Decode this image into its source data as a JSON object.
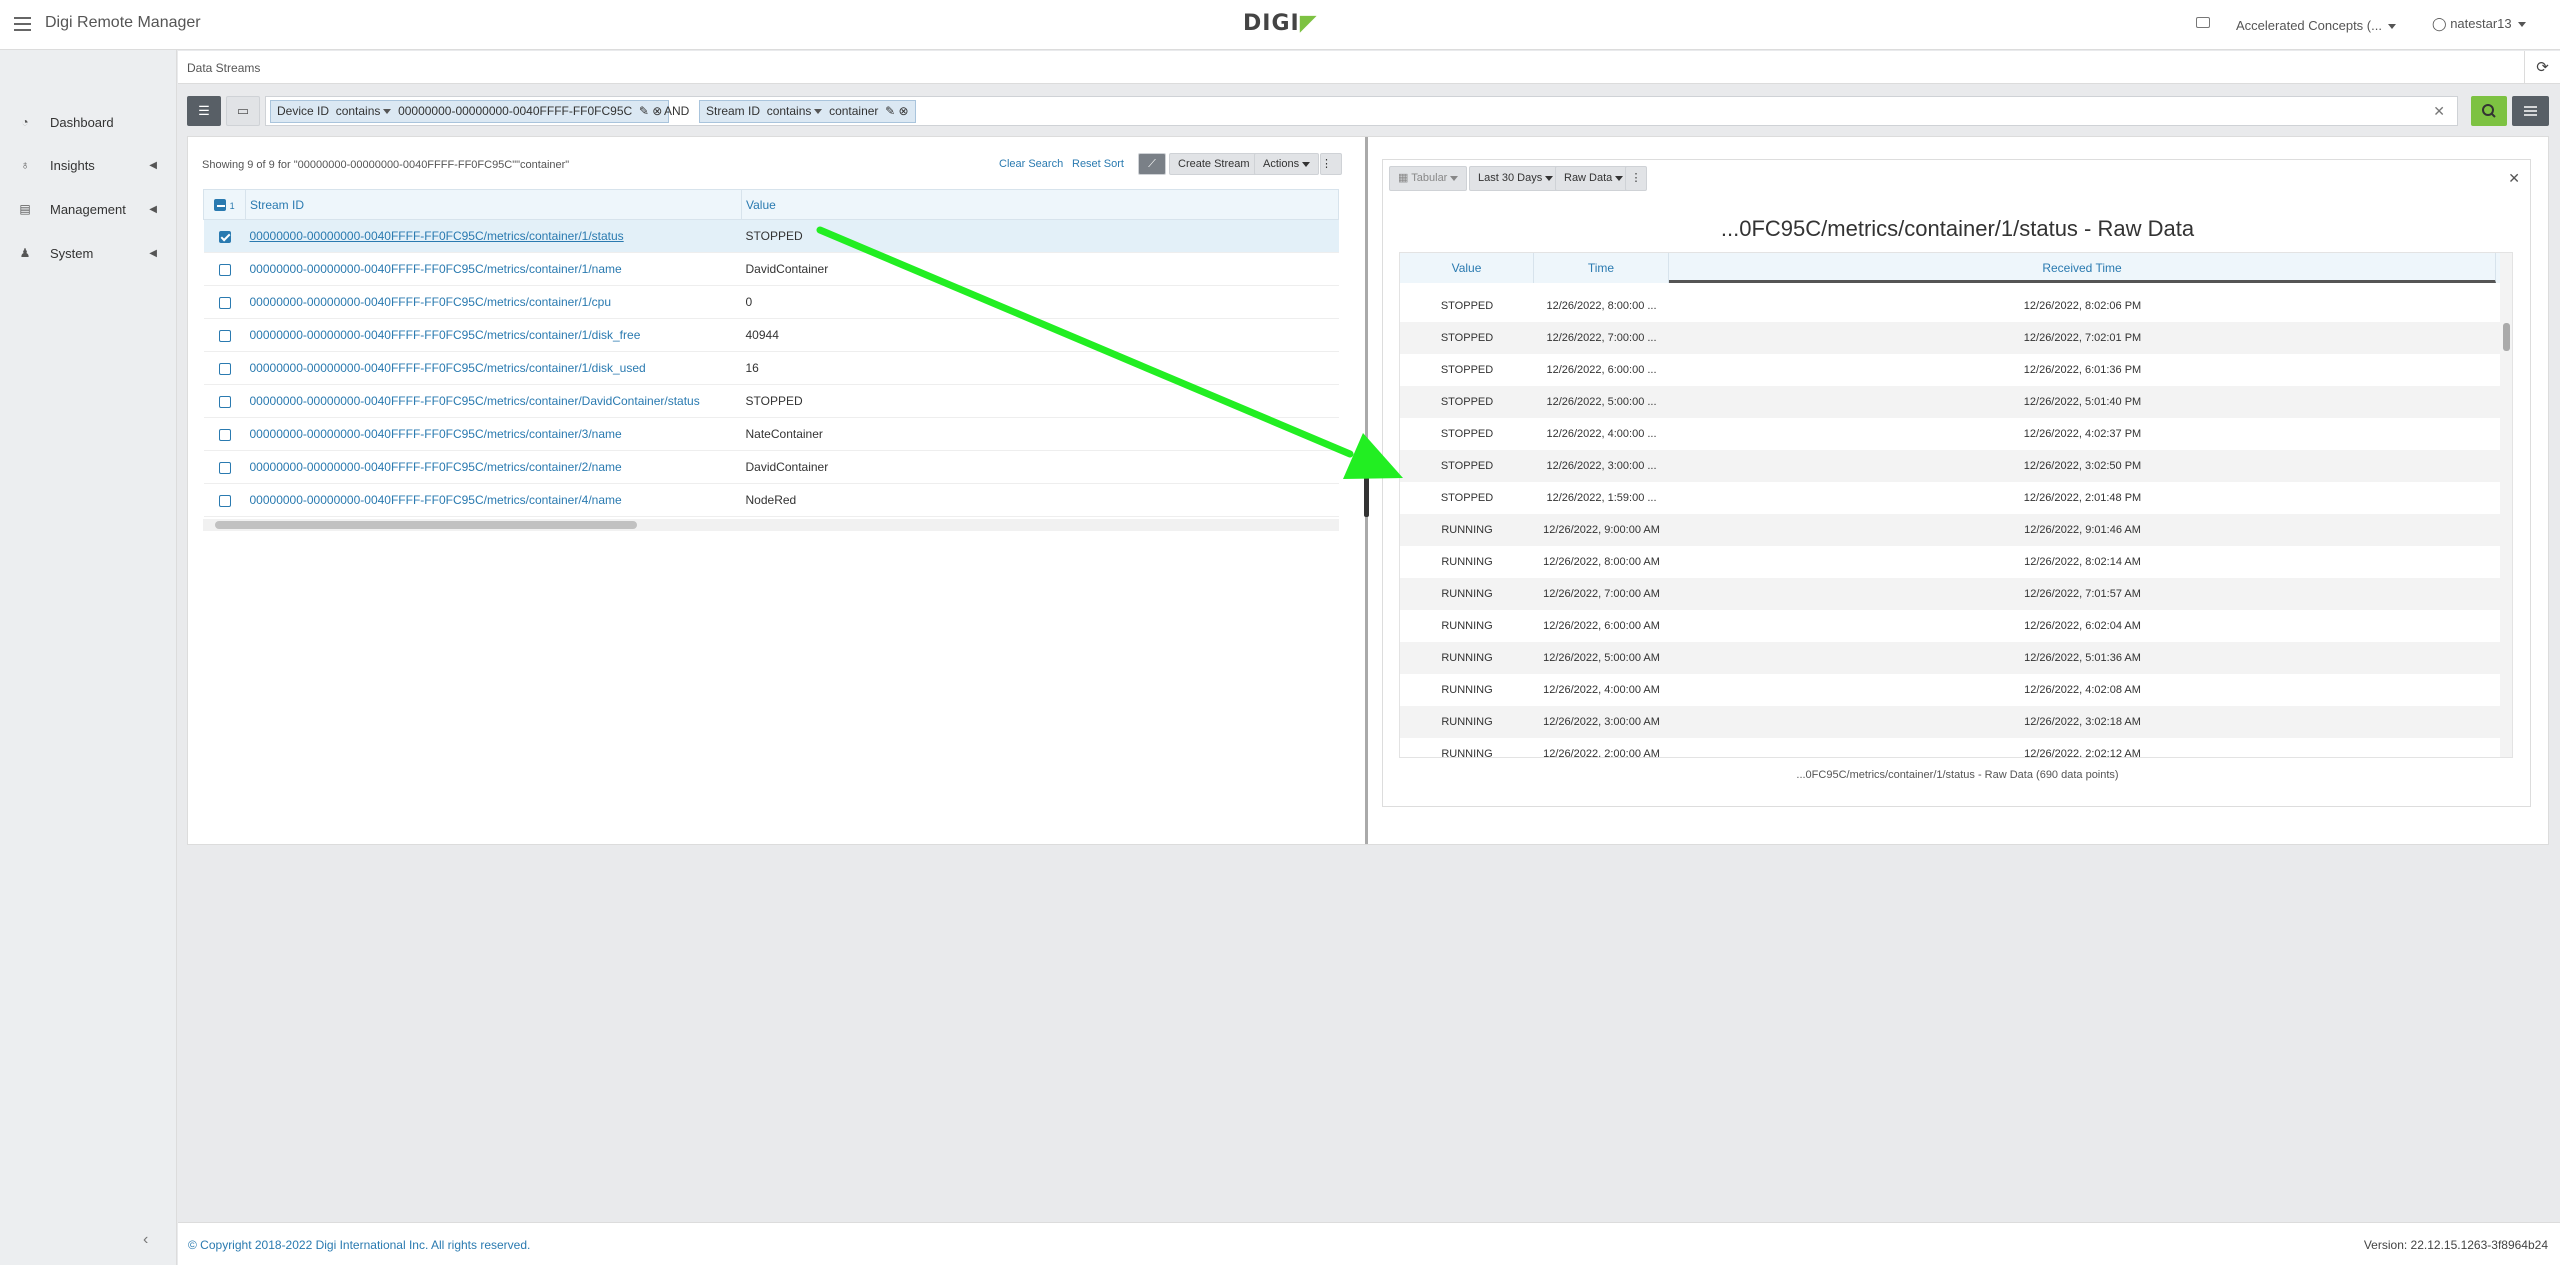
{
  "app": {
    "title": "Digi Remote Manager",
    "logo_text": "DIGI"
  },
  "header": {
    "org": "Accelerated Concepts (...",
    "user": "natestar13"
  },
  "sidebar": {
    "items": [
      {
        "label": "Dashboard",
        "icon": "gauge-icon"
      },
      {
        "label": "Insights",
        "icon": "lightbulb-icon"
      },
      {
        "label": "Management",
        "icon": "server-icon"
      },
      {
        "label": "System",
        "icon": "user-cog-icon"
      }
    ]
  },
  "breadcrumb": "Data Streams",
  "filter": {
    "chip1": {
      "field": "Device ID",
      "op": "contains",
      "value": "00000000-00000000-0040FFFF-FF0FC95C"
    },
    "and": "AND",
    "chip2": {
      "field": "Stream ID",
      "op": "contains",
      "value": "container"
    }
  },
  "list": {
    "showing": "Showing 9 of 9 for \"00000000-00000000-0040FFFF-FF0FC95C\"\"container\"",
    "clear_search": "Clear Search",
    "reset_sort": "Reset Sort",
    "create_stream": "Create Stream",
    "actions": "Actions",
    "sort_index": "1",
    "col_stream": "Stream ID",
    "col_value": "Value",
    "rows": [
      {
        "id": "00000000-00000000-0040FFFF-FF0FC95C/metrics/container/1/status",
        "value": "STOPPED"
      },
      {
        "id": "00000000-00000000-0040FFFF-FF0FC95C/metrics/container/1/name",
        "value": "DavidContainer"
      },
      {
        "id": "00000000-00000000-0040FFFF-FF0FC95C/metrics/container/1/cpu",
        "value": "0"
      },
      {
        "id": "00000000-00000000-0040FFFF-FF0FC95C/metrics/container/1/disk_free",
        "value": "40944"
      },
      {
        "id": "00000000-00000000-0040FFFF-FF0FC95C/metrics/container/1/disk_used",
        "value": "16"
      },
      {
        "id": "00000000-00000000-0040FFFF-FF0FC95C/metrics/container/DavidContainer/status",
        "value": "STOPPED"
      },
      {
        "id": "00000000-00000000-0040FFFF-FF0FC95C/metrics/container/3/name",
        "value": "NateContainer"
      },
      {
        "id": "00000000-00000000-0040FFFF-FF0FC95C/metrics/container/2/name",
        "value": "DavidContainer"
      },
      {
        "id": "00000000-00000000-0040FFFF-FF0FC95C/metrics/container/4/name",
        "value": "NodeRed"
      }
    ]
  },
  "detail": {
    "view": "Tabular",
    "range": "Last 30 Days",
    "data_type": "Raw Data",
    "title": "...0FC95C/metrics/container/1/status - Raw Data",
    "col_value": "Value",
    "col_time": "Time",
    "col_received": "Received Time",
    "rows": [
      {
        "value": "STOPPED",
        "time": "12/26/2022, 8:00:00 ...",
        "received": "12/26/2022, 8:02:06 PM"
      },
      {
        "value": "STOPPED",
        "time": "12/26/2022, 7:00:00 ...",
        "received": "12/26/2022, 7:02:01 PM"
      },
      {
        "value": "STOPPED",
        "time": "12/26/2022, 6:00:00 ...",
        "received": "12/26/2022, 6:01:36 PM"
      },
      {
        "value": "STOPPED",
        "time": "12/26/2022, 5:00:00 ...",
        "received": "12/26/2022, 5:01:40 PM"
      },
      {
        "value": "STOPPED",
        "time": "12/26/2022, 4:00:00 ...",
        "received": "12/26/2022, 4:02:37 PM"
      },
      {
        "value": "STOPPED",
        "time": "12/26/2022, 3:00:00 ...",
        "received": "12/26/2022, 3:02:50 PM"
      },
      {
        "value": "STOPPED",
        "time": "12/26/2022, 1:59:00 ...",
        "received": "12/26/2022, 2:01:48 PM"
      },
      {
        "value": "RUNNING",
        "time": "12/26/2022, 9:00:00 AM",
        "received": "12/26/2022, 9:01:46 AM"
      },
      {
        "value": "RUNNING",
        "time": "12/26/2022, 8:00:00 AM",
        "received": "12/26/2022, 8:02:14 AM"
      },
      {
        "value": "RUNNING",
        "time": "12/26/2022, 7:00:00 AM",
        "received": "12/26/2022, 7:01:57 AM"
      },
      {
        "value": "RUNNING",
        "time": "12/26/2022, 6:00:00 AM",
        "received": "12/26/2022, 6:02:04 AM"
      },
      {
        "value": "RUNNING",
        "time": "12/26/2022, 5:00:00 AM",
        "received": "12/26/2022, 5:01:36 AM"
      },
      {
        "value": "RUNNING",
        "time": "12/26/2022, 4:00:00 AM",
        "received": "12/26/2022, 4:02:08 AM"
      },
      {
        "value": "RUNNING",
        "time": "12/26/2022, 3:00:00 AM",
        "received": "12/26/2022, 3:02:18 AM"
      },
      {
        "value": "RUNNING",
        "time": "12/26/2022, 2:00:00 AM",
        "received": "12/26/2022, 2:02:12 AM"
      }
    ],
    "footer": "...0FC95C/metrics/container/1/status - Raw Data (690 data points)"
  },
  "footer": {
    "copyright": "© Copyright 2018-2022 Digi International Inc. All rights reserved.",
    "version": "Version: 22.12.15.1263-3f8964b24"
  },
  "colors": {
    "accent": "#2a7ab0",
    "brand_green": "#7dc242",
    "annotation": "#22ee22"
  }
}
